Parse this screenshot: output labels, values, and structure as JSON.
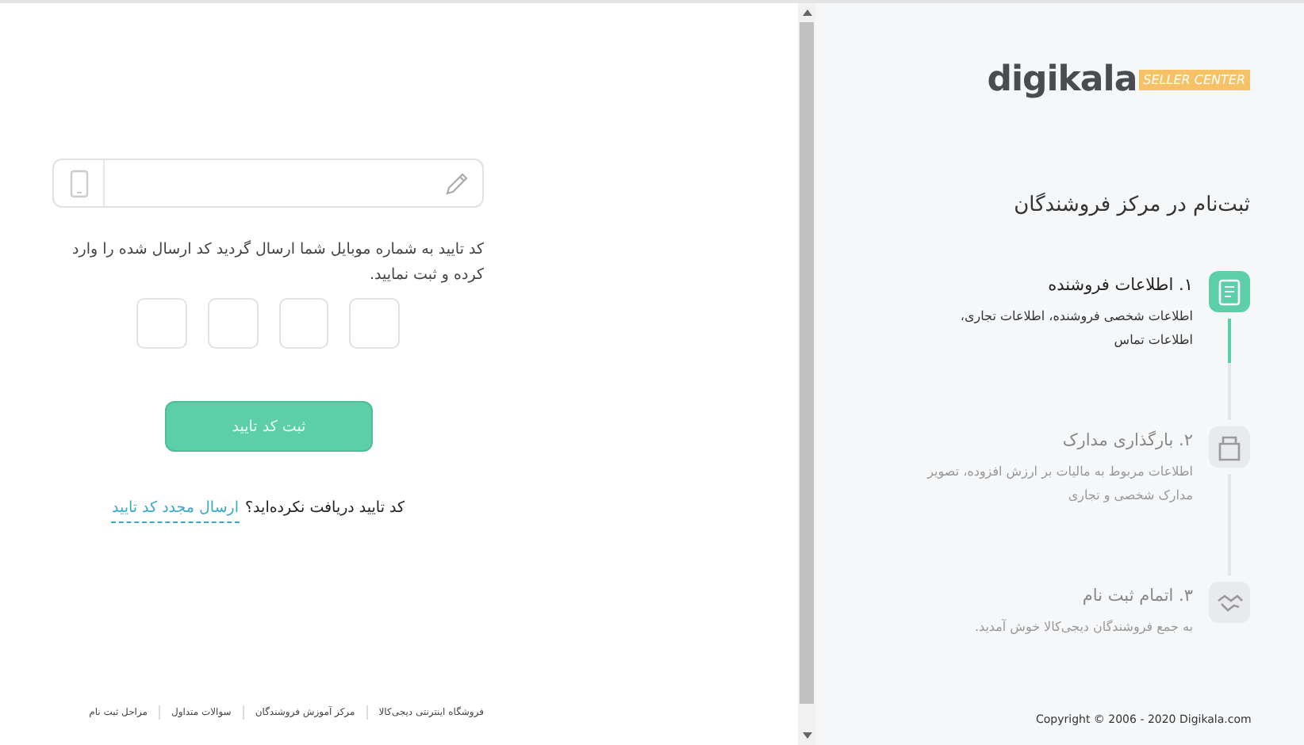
{
  "form": {
    "instruction": "کد تایید به شماره موبایل شما ارسال گردید کد ارسال شده را وارد کرده و ثبت نمایید.",
    "code_inputs": [
      {
        "filled": false
      },
      {
        "filled": false
      },
      {
        "filled": false
      },
      {
        "filled": false
      }
    ],
    "submit_button": "ثبت کد تایید",
    "resend_prompt": "کد تایید دریافت نکرده‌اید؟",
    "resend_link": "ارسال مجدد کد تایید"
  },
  "footer_links": [
    "فروشگاه اینترنتی دیجی‌کالا",
    "مرکز آموزش فروشندگان",
    "سوالات متداول",
    "مراحل ثبت نام"
  ],
  "sidebar": {
    "logo": {
      "name": "digikala",
      "badge": "SELLER CENTER"
    },
    "title": "ثبت‌نام  در مرکز فروشندگان",
    "steps": [
      {
        "kind": "form",
        "title": "۱. اطلاعات فروشنده",
        "description": "اطلاعات شخصی فروشنده، اطلاعات تجاری، اطلاعات تماس",
        "selected": true
      },
      {
        "kind": "upload",
        "title": "۲. بارگذاری مدارک",
        "description": "اطلاعات مربوط به مالیات بر ارزش افزوده، تصویر مدارک شخصی و تجاری",
        "selected": false
      },
      {
        "kind": "handshake",
        "title": "۳. اتمام ثبت نام",
        "description": "به جمع فروشندگان دیجی‌کالا خوش آمدید.",
        "selected": false
      }
    ],
    "copyright": "Copyright © 2006 - 2020 Digikala.com"
  }
}
